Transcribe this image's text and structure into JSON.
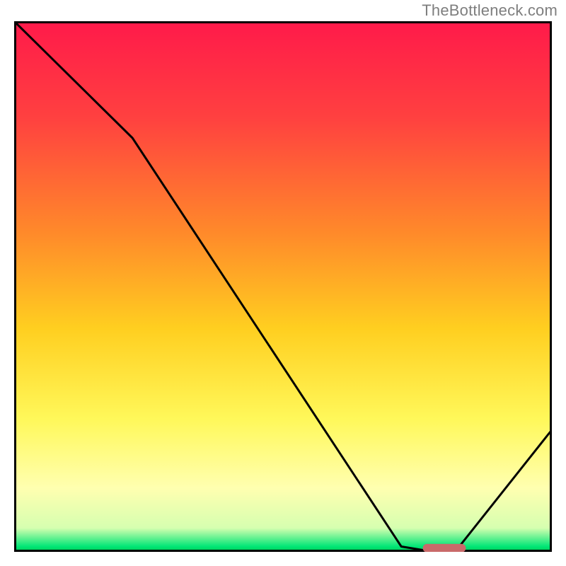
{
  "attribution": "TheBottleneck.com",
  "chart_data": {
    "type": "line",
    "title": "",
    "xlabel": "",
    "ylabel": "",
    "xlim": [
      0,
      100
    ],
    "ylim": [
      0,
      100
    ],
    "curve": [
      {
        "x": 0,
        "y": 100
      },
      {
        "x": 22,
        "y": 78
      },
      {
        "x": 72,
        "y": 1
      },
      {
        "x": 78,
        "y": 0
      },
      {
        "x": 82,
        "y": 0
      },
      {
        "x": 100,
        "y": 23
      }
    ],
    "flat_marker": {
      "x0": 76,
      "x1": 84,
      "y": 0.7
    },
    "gradient_stops": [
      {
        "offset": 0.0,
        "color": "#ff1a4a"
      },
      {
        "offset": 0.18,
        "color": "#ff4040"
      },
      {
        "offset": 0.4,
        "color": "#ff8a2a"
      },
      {
        "offset": 0.58,
        "color": "#ffcf20"
      },
      {
        "offset": 0.75,
        "color": "#fff85a"
      },
      {
        "offset": 0.88,
        "color": "#ffffb0"
      },
      {
        "offset": 0.955,
        "color": "#d6ffb0"
      },
      {
        "offset": 0.99,
        "color": "#00e676"
      },
      {
        "offset": 1.0,
        "color": "#00c853"
      }
    ],
    "border_color": "#000000",
    "curve_color": "#000000",
    "marker_color": "#c96a6a"
  }
}
